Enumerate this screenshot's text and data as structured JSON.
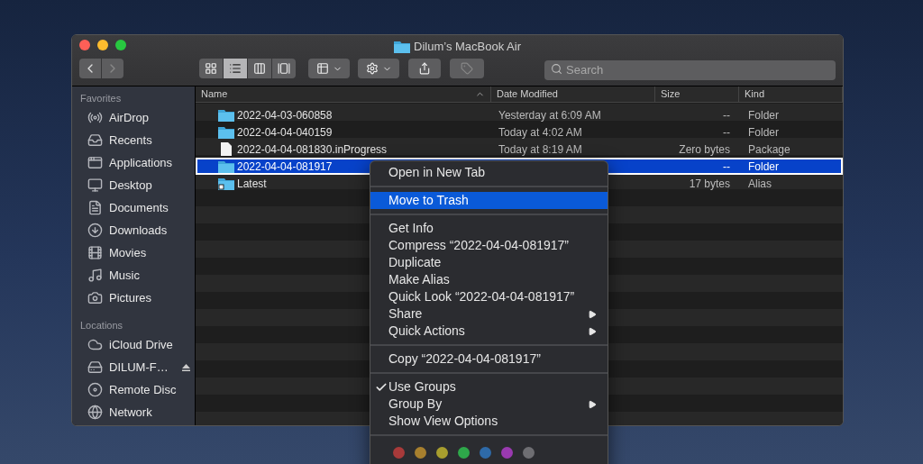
{
  "window": {
    "title": "Dilum’s MacBook Air"
  },
  "toolbar": {
    "back": {
      "disabled": false
    },
    "forward": {
      "disabled": true
    },
    "view_modes": [
      {
        "selected": false
      },
      {
        "selected": true
      },
      {
        "selected": false
      },
      {
        "selected": false
      }
    ],
    "tag_button": {
      "disabled": true
    },
    "search": {
      "placeholder": "Search"
    }
  },
  "sidebar": {
    "sections": [
      {
        "title": "Favorites",
        "items": [
          {
            "label": "AirDrop"
          },
          {
            "label": "Recents"
          },
          {
            "label": "Applications"
          },
          {
            "label": "Desktop"
          },
          {
            "label": "Documents"
          },
          {
            "label": "Downloads"
          },
          {
            "label": "Movies"
          },
          {
            "label": "Music"
          },
          {
            "label": "Pictures"
          }
        ]
      },
      {
        "title": "Locations",
        "items": [
          {
            "label": "iCloud Drive",
            "eject": false
          },
          {
            "label": "DILUM-F…",
            "eject": true
          },
          {
            "label": "Remote Disc",
            "eject": false
          },
          {
            "label": "Network",
            "eject": false
          }
        ]
      }
    ]
  },
  "table": {
    "columns": [
      {
        "label": "Name",
        "sorted": true
      },
      {
        "label": "Date Modified",
        "sorted": false
      },
      {
        "label": "Size",
        "sorted": false
      },
      {
        "label": "Kind",
        "sorted": false
      }
    ],
    "rows": [
      {
        "cells": [
          "2022-04-03-060858",
          "Yesterday at 6:09 AM",
          "--",
          "Folder"
        ],
        "selected": false
      },
      {
        "cells": [
          "2022-04-04-040159",
          "Today at 4:02 AM",
          "--",
          "Folder"
        ],
        "selected": false
      },
      {
        "cells": [
          "2022-04-04-081830.inProgress",
          "Today at 8:19 AM",
          "Zero bytes",
          "Package"
        ],
        "selected": false
      },
      {
        "cells": [
          "2022-04-04-081917",
          "",
          "--",
          "Folder"
        ],
        "selected": true
      },
      {
        "cells": [
          "Latest",
          "",
          "17 bytes",
          "Alias"
        ],
        "selected": false
      }
    ]
  },
  "context_menu": {
    "groups": [
      [
        {
          "label": "Open in New Tab",
          "selected": false,
          "checked": false,
          "submenu": false
        }
      ],
      [
        {
          "label": "Move to Trash",
          "selected": true,
          "checked": false,
          "submenu": false
        }
      ],
      [
        {
          "label": "Get Info",
          "selected": false,
          "checked": false,
          "submenu": false
        },
        {
          "label": "Compress “2022-04-04-081917”",
          "selected": false,
          "checked": false,
          "submenu": false
        },
        {
          "label": "Duplicate",
          "selected": false,
          "checked": false,
          "submenu": false
        },
        {
          "label": "Make Alias",
          "selected": false,
          "checked": false,
          "submenu": false
        },
        {
          "label": "Quick Look “2022-04-04-081917”",
          "selected": false,
          "checked": false,
          "submenu": false
        },
        {
          "label": "Share",
          "selected": false,
          "checked": false,
          "submenu": true
        },
        {
          "label": "Quick Actions",
          "selected": false,
          "checked": false,
          "submenu": true
        }
      ],
      [
        {
          "label": "Copy “2022-04-04-081917”",
          "selected": false,
          "checked": false,
          "submenu": false
        }
      ],
      [
        {
          "label": "Use Groups",
          "selected": false,
          "checked": true,
          "submenu": false
        },
        {
          "label": "Group By",
          "selected": false,
          "checked": false,
          "submenu": true
        },
        {
          "label": "Show View Options",
          "selected": false,
          "checked": false,
          "submenu": false
        }
      ]
    ],
    "tags": [
      {
        "color": "#a83a3a"
      },
      {
        "color": "#a8802e"
      },
      {
        "color": "#a89e2e"
      },
      {
        "color": "#2ea84a"
      },
      {
        "color": "#2e6aa8"
      },
      {
        "color": "#9a3ab0"
      },
      {
        "color": "#6e6e72"
      }
    ]
  }
}
